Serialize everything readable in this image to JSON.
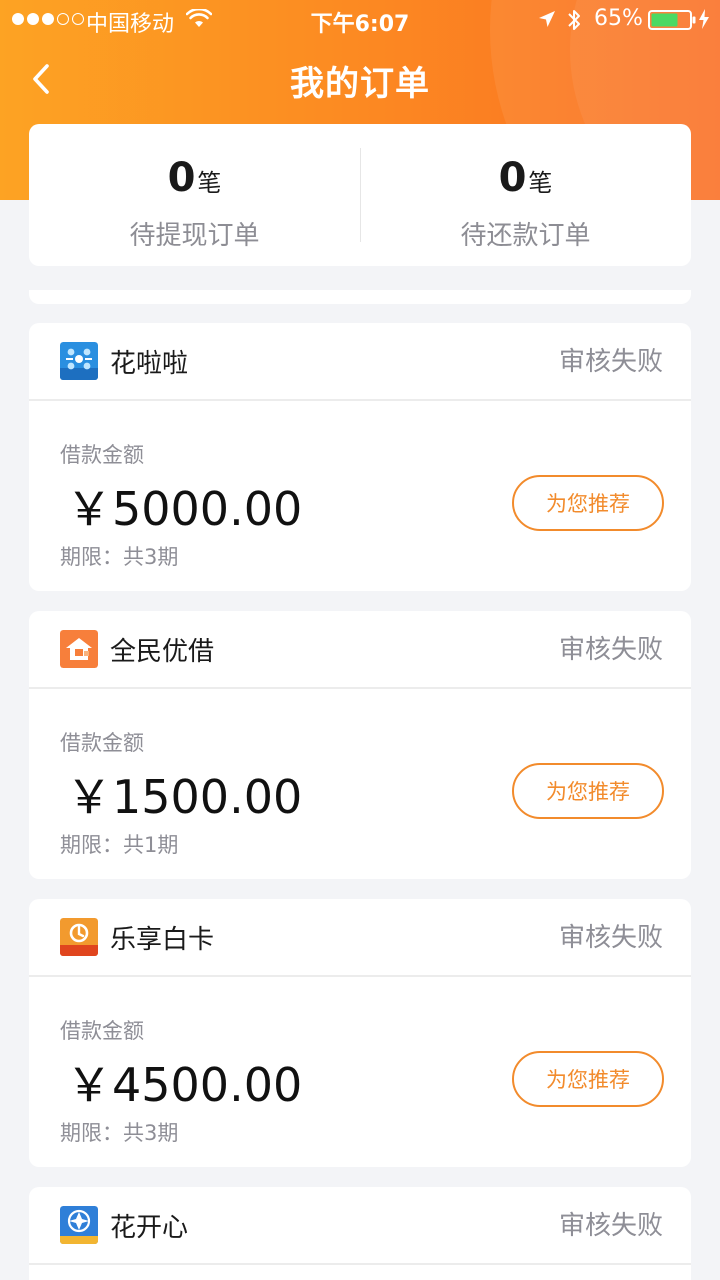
{
  "status_bar": {
    "carrier": "中国移动",
    "time": "下午6:07",
    "battery": "65%"
  },
  "nav": {
    "title": "我的订单"
  },
  "summary": [
    {
      "count": "0",
      "unit": "笔",
      "label": "待提现订单"
    },
    {
      "count": "0",
      "unit": "笔",
      "label": "待还款订单"
    }
  ],
  "orders": [
    {
      "name": "花啦啦",
      "status": "审核失败",
      "amount_label": "借款金额",
      "amount": "￥5000.00",
      "term": "期限：共3期",
      "button": "为您推荐",
      "icon": "hualala-logo-icon"
    },
    {
      "name": "全民优借",
      "status": "审核失败",
      "amount_label": "借款金额",
      "amount": "￥1500.00",
      "term": "期限：共1期",
      "button": "为您推荐",
      "icon": "quanmin-logo-icon"
    },
    {
      "name": "乐享白卡",
      "status": "审核失败",
      "amount_label": "借款金额",
      "amount": "￥4500.00",
      "term": "期限：共3期",
      "button": "为您推荐",
      "icon": "lexiang-logo-icon"
    },
    {
      "name": "花开心",
      "status": "审核失败",
      "icon": "huakaixin-logo-icon"
    }
  ],
  "colors": {
    "accent": "#f28b2c",
    "header_start": "#fda323",
    "header_end": "#fa6e22",
    "muted_text": "#8e8e96"
  }
}
